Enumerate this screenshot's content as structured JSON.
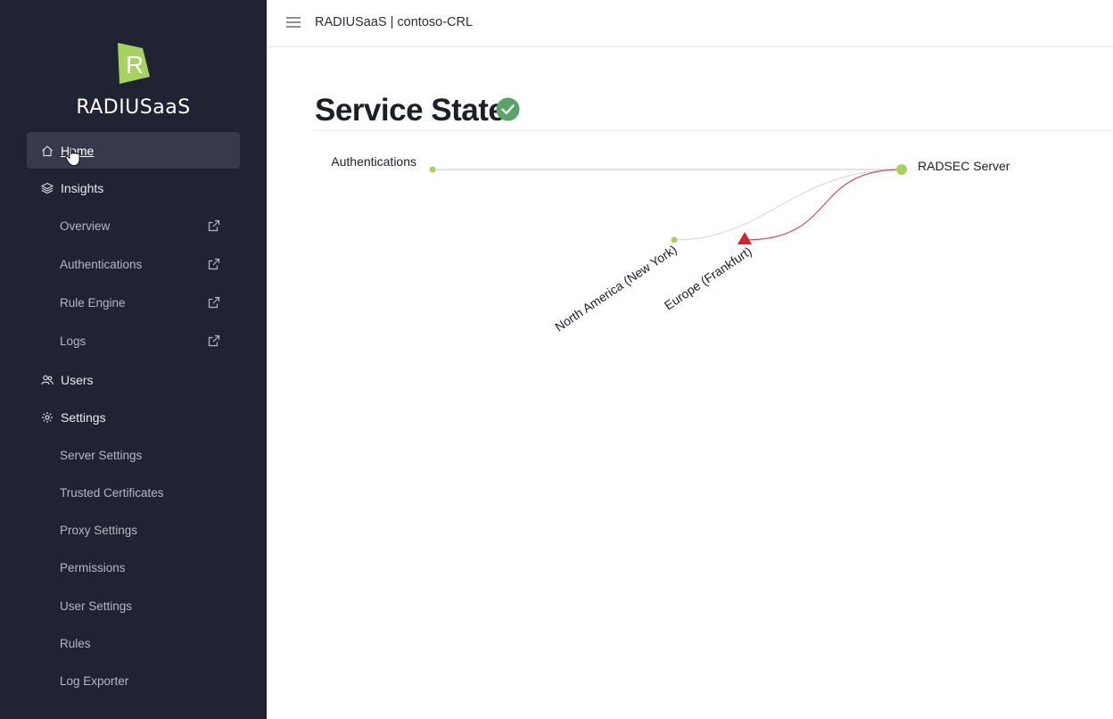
{
  "sidebar": {
    "brand": "RADIUSaaS",
    "nav": [
      {
        "label": "Home",
        "icon": "home-icon"
      },
      {
        "label": "Insights",
        "icon": "layers-icon"
      },
      {
        "label": "Users",
        "icon": "users-icon"
      },
      {
        "label": "Settings",
        "icon": "gear-icon"
      }
    ],
    "insights_sub": [
      {
        "label": "Overview",
        "icon": "external-link-icon"
      },
      {
        "label": "Authentications",
        "icon": "external-link-icon"
      },
      {
        "label": "Rule Engine",
        "icon": "external-link-icon"
      },
      {
        "label": "Logs",
        "icon": "external-link-icon"
      }
    ],
    "settings_sub": [
      {
        "label": "Server Settings"
      },
      {
        "label": "Trusted Certificates"
      },
      {
        "label": "Proxy Settings"
      },
      {
        "label": "Permissions"
      },
      {
        "label": "User Settings"
      },
      {
        "label": "Rules"
      },
      {
        "label": "Log Exporter"
      }
    ]
  },
  "topbar": {
    "title": "RADIUSaaS | contoso-CRL"
  },
  "main": {
    "title": "Service State",
    "status_icon": "check-circle-icon",
    "status_color": "#5aa469"
  },
  "diagram": {
    "nodes": {
      "authentications": "Authentications",
      "radsec": "RADSEC Server",
      "north_america": "North America (New York)",
      "europe": "Europe (Frankfurt)"
    },
    "colors": {
      "ok": "#a6d35f",
      "error": "#d4202a",
      "link": "#d9dbe0",
      "error_link": "#d0505a"
    }
  }
}
